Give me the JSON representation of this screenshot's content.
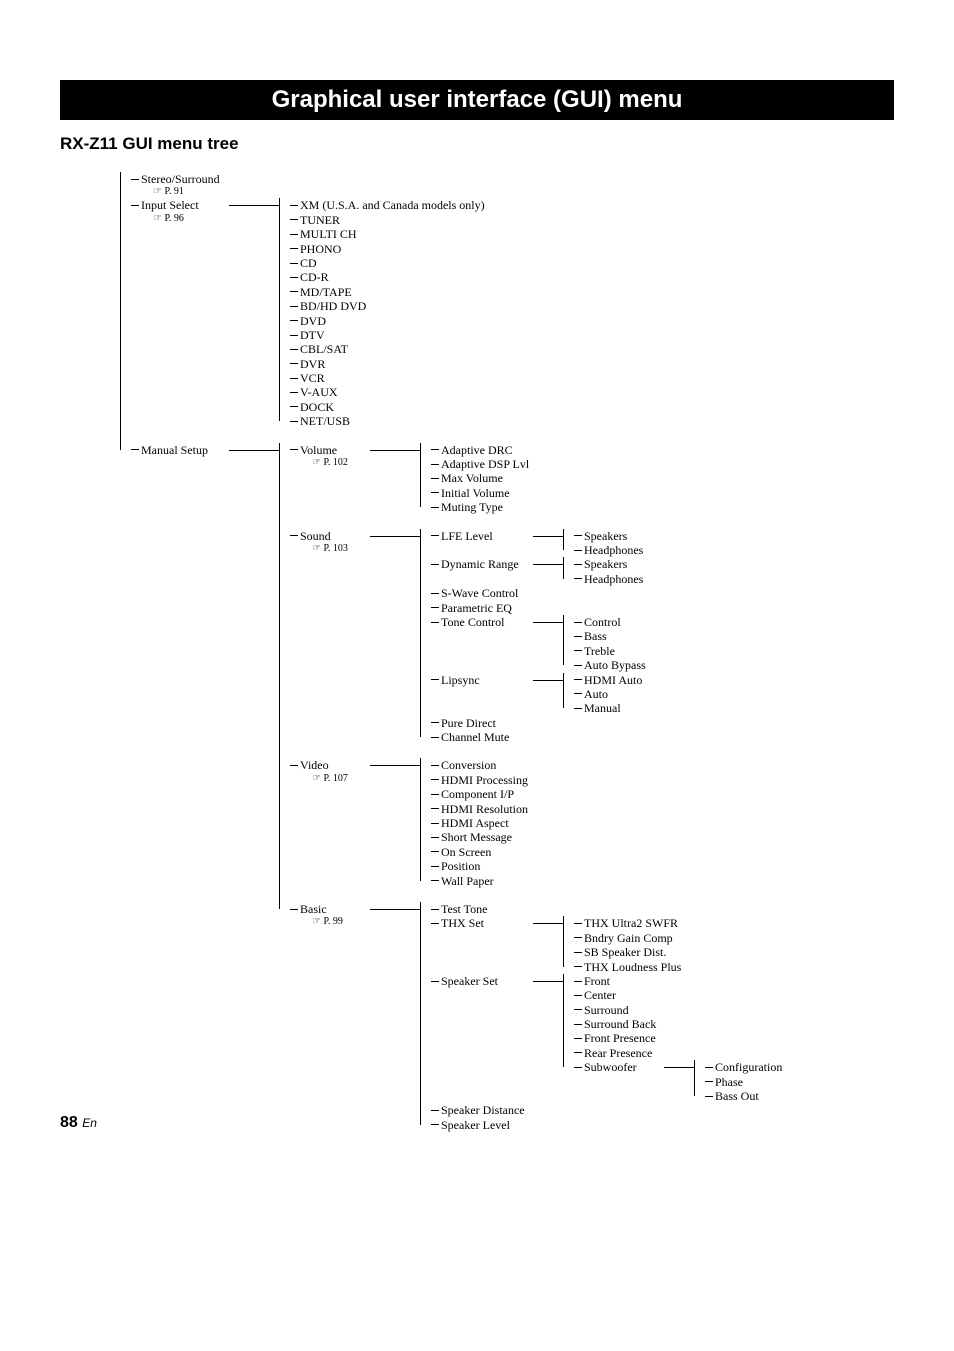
{
  "title": "Graphical user interface (GUI) menu",
  "subtitle": "RX-Z11 GUI menu tree",
  "page_number": "88",
  "page_lang": "En",
  "ref_pointer": "☞",
  "tree": {
    "stereo_surround": {
      "label": "Stereo/Surround",
      "ref": "P. 91"
    },
    "input_select": {
      "label": "Input Select",
      "ref": "P. 96",
      "items": [
        "XM (U.S.A. and Canada models only)",
        "TUNER",
        "MULTI CH",
        "PHONO",
        "CD",
        "CD-R",
        "MD/TAPE",
        "BD/HD DVD",
        "DVD",
        "DTV",
        "CBL/SAT",
        "DVR",
        "VCR",
        "V-AUX",
        "DOCK",
        "NET/USB"
      ]
    },
    "manual_setup": {
      "label": "Manual Setup",
      "volume": {
        "label": "Volume",
        "ref": "P. 102",
        "items": [
          "Adaptive DRC",
          "Adaptive DSP Lvl",
          "Max Volume",
          "Initial Volume",
          "Muting Type"
        ]
      },
      "sound": {
        "label": "Sound",
        "ref": "P. 103",
        "lfe_level": {
          "label": "LFE Level",
          "items": [
            "Speakers",
            "Headphones"
          ]
        },
        "dynamic_range": {
          "label": "Dynamic Range",
          "items": [
            "Speakers",
            "Headphones"
          ]
        },
        "s_wave": "S-Wave Control",
        "parametric_eq": "Parametric EQ",
        "tone_control": {
          "label": "Tone Control",
          "items": [
            "Control",
            "Bass",
            "Treble",
            "Auto Bypass"
          ]
        },
        "lipsync": {
          "label": "Lipsync",
          "items": [
            "HDMI Auto",
            "Auto",
            "Manual"
          ]
        },
        "pure_direct": "Pure Direct",
        "channel_mute": "Channel Mute"
      },
      "video": {
        "label": "Video",
        "ref": "P. 107",
        "items": [
          "Conversion",
          "HDMI Processing",
          "Component I/P",
          "HDMI Resolution",
          "HDMI Aspect",
          "Short Message",
          "On Screen",
          "Position",
          "Wall Paper"
        ]
      },
      "basic": {
        "label": "Basic",
        "ref": "P. 99",
        "test_tone": "Test Tone",
        "thx_set": {
          "label": "THX Set",
          "items": [
            "THX Ultra2 SWFR",
            "Bndry Gain Comp",
            "SB Speaker Dist.",
            "THX Loudness Plus"
          ]
        },
        "speaker_set": {
          "label": "Speaker Set",
          "items": [
            "Front",
            "Center",
            "Surround",
            "Surround Back",
            "Front Presence",
            "Rear Presence"
          ],
          "subwoofer": {
            "label": "Subwoofer",
            "items": [
              "Configuration",
              "Phase",
              "Bass Out"
            ]
          }
        },
        "speaker_distance": "Speaker Distance",
        "speaker_level": "Speaker Level"
      }
    }
  }
}
